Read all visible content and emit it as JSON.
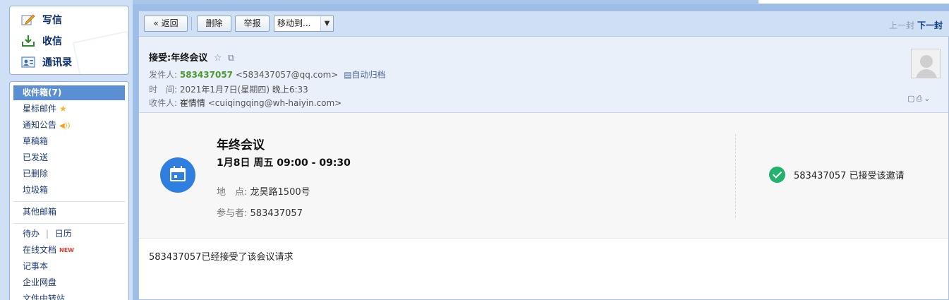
{
  "quick": {
    "compose": "写信",
    "receive": "收信",
    "contacts": "通讯录"
  },
  "folders": {
    "inbox": "收件箱(7)",
    "starred": "星标邮件",
    "notice": "通知公告",
    "drafts": "草稿箱",
    "sent": "已发送",
    "deleted": "已删除",
    "spam": "垃圾箱",
    "other": "其他邮箱",
    "todo": "待办",
    "todo_sep": "|",
    "calendar": "日历",
    "docs": "在线文档",
    "docs_badge": "NEW",
    "notes": "记事本",
    "disk": "企业网盘",
    "transfer": "文件中转站"
  },
  "toolbar": {
    "back": "« 返回",
    "delete": "删除",
    "report": "举报",
    "move": "移动到...",
    "prev": "上一封",
    "next": "下一封"
  },
  "header": {
    "subject": "接受:年终会议",
    "from_label": "发件人:",
    "from_name": "583437057",
    "from_email": "<583437057@qq.com>",
    "archive": "自动归档",
    "time_label": "时　间:",
    "time_value": "2021年1月7日(星期四) 晚上6:33",
    "to_label": "收件人:",
    "to_name": "崔情情",
    "to_email": "<cuiqingqing@wh-haiyin.com>"
  },
  "invite": {
    "title": "年终会议",
    "time": "1月8日 周五 09:00 - 09:30",
    "location_label": "地　点:",
    "location": "龙昊路1500号",
    "attendees_label": "参与者:",
    "attendees": "583437057",
    "status": "583437057 已接受该邀请"
  },
  "body": {
    "text": "583437057已经接受了该会议请求"
  },
  "colors": {
    "accent": "#5b8fd4",
    "calendar_icon": "#2f7fe0",
    "accepted_check": "#21b26b",
    "sender_name": "#4a9a2e"
  }
}
